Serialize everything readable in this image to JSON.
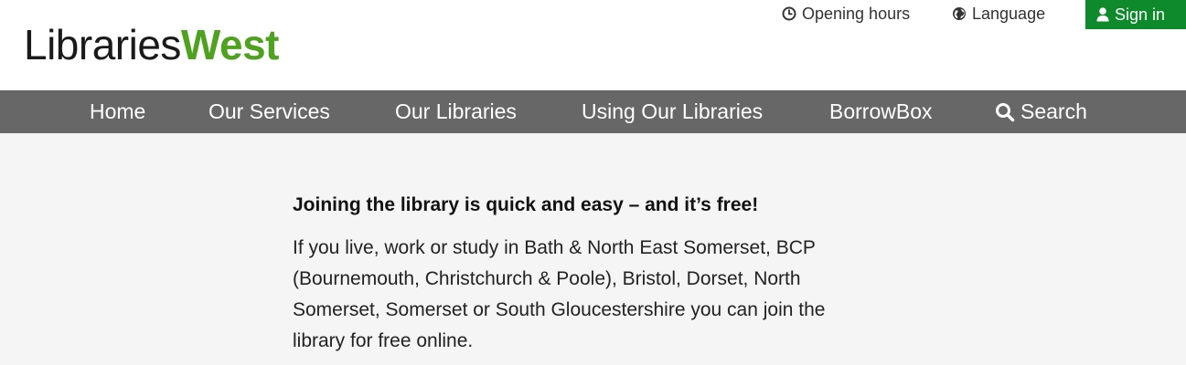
{
  "logo": {
    "part1": "Libraries",
    "part2": "West"
  },
  "utility": {
    "opening_hours": "Opening hours",
    "language": "Language",
    "sign_in": "Sign in"
  },
  "nav": {
    "home": "Home",
    "services": "Our Services",
    "libraries": "Our Libraries",
    "using": "Using Our Libraries",
    "borrowbox": "BorrowBox",
    "search": "Search"
  },
  "main": {
    "lead": "Joining the library is quick and easy – and it’s free!",
    "body": "If you live, work or study in Bath & North East Somerset, BCP (Bournemouth, Christchurch & Poole), Bristol, Dorset, North Somerset, Somerset or South Gloucestershire you can join the library for free online."
  },
  "icons": {
    "opening_hours": "clock-icon",
    "language": "globe-icon",
    "sign_in": "user-icon",
    "search": "search-icon"
  },
  "colors": {
    "brand_green": "#4fa21f",
    "signin_bg": "#0e8a2c",
    "nav_bg": "#676767",
    "main_bg": "#f5f5f5"
  }
}
